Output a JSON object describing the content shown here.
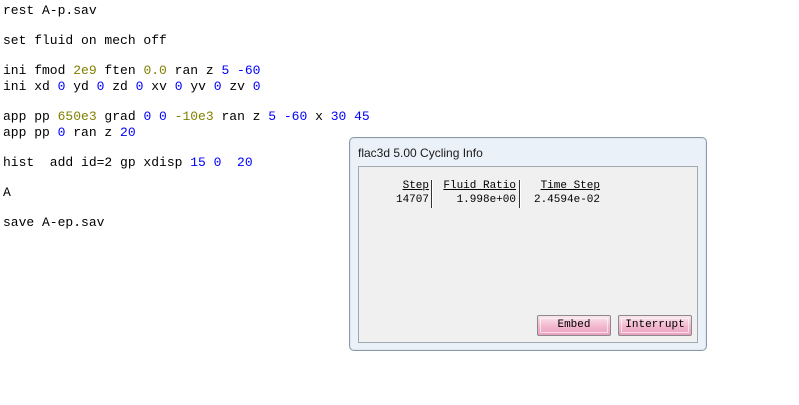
{
  "editor": {
    "lines": [
      {
        "tokens": [
          {
            "t": "rest A-p.sav",
            "c": "kw"
          }
        ]
      },
      {
        "tokens": [
          {
            "t": "set fluid on mech off",
            "c": "kw"
          }
        ]
      },
      {
        "tokens": [
          {
            "t": "ini fmod ",
            "c": "kw"
          },
          {
            "t": "2e9",
            "c": "exp"
          },
          {
            "t": " ften ",
            "c": "kw"
          },
          {
            "t": "0.0",
            "c": "exp"
          },
          {
            "t": " ran z ",
            "c": "kw"
          },
          {
            "t": "5 -60",
            "c": "num"
          }
        ]
      },
      {
        "tokens": [
          {
            "t": "ini xd ",
            "c": "kw"
          },
          {
            "t": "0",
            "c": "num"
          },
          {
            "t": " yd ",
            "c": "kw"
          },
          {
            "t": "0",
            "c": "num"
          },
          {
            "t": " zd ",
            "c": "kw"
          },
          {
            "t": "0",
            "c": "num"
          },
          {
            "t": " xv ",
            "c": "kw"
          },
          {
            "t": "0",
            "c": "num"
          },
          {
            "t": " yv ",
            "c": "kw"
          },
          {
            "t": "0",
            "c": "num"
          },
          {
            "t": " zv ",
            "c": "kw"
          },
          {
            "t": "0",
            "c": "num"
          }
        ]
      },
      {
        "tokens": [
          {
            "t": "app pp ",
            "c": "kw"
          },
          {
            "t": "650e3",
            "c": "exp"
          },
          {
            "t": " grad ",
            "c": "kw"
          },
          {
            "t": "0 0",
            "c": "num"
          },
          {
            "t": " ",
            "c": "kw"
          },
          {
            "t": "-10e3",
            "c": "exp"
          },
          {
            "t": " ran z ",
            "c": "kw"
          },
          {
            "t": "5 -60",
            "c": "num"
          },
          {
            "t": " x ",
            "c": "kw"
          },
          {
            "t": "30 45",
            "c": "num"
          }
        ]
      },
      {
        "tokens": [
          {
            "t": "app pp ",
            "c": "kw"
          },
          {
            "t": "0",
            "c": "num"
          },
          {
            "t": " ran z ",
            "c": "kw"
          },
          {
            "t": "20",
            "c": "num"
          }
        ]
      },
      {
        "tokens": [
          {
            "t": "hist  add id=2 gp xdisp ",
            "c": "kw"
          },
          {
            "t": "15 0  20",
            "c": "num"
          }
        ]
      },
      {
        "tokens": [
          {
            "t": "A",
            "c": "kw"
          }
        ]
      },
      {
        "tokens": [
          {
            "t": "save A-ep.sav",
            "c": "kw"
          }
        ]
      }
    ]
  },
  "dialog": {
    "title": "flac3d 5.00 Cycling Info",
    "columns": [
      {
        "header": "Step",
        "value": "14707"
      },
      {
        "header": "Fluid Ratio",
        "value": "1.998e+00"
      },
      {
        "header": "Time Step",
        "value": "2.4594e-02"
      }
    ],
    "buttons": {
      "embed": "Embed",
      "interrupt": "Interrupt"
    }
  },
  "colors": {
    "keyword": "#000000",
    "number": "#0000ff",
    "exponent": "#808000",
    "button_pink": "#f2b6cd"
  }
}
